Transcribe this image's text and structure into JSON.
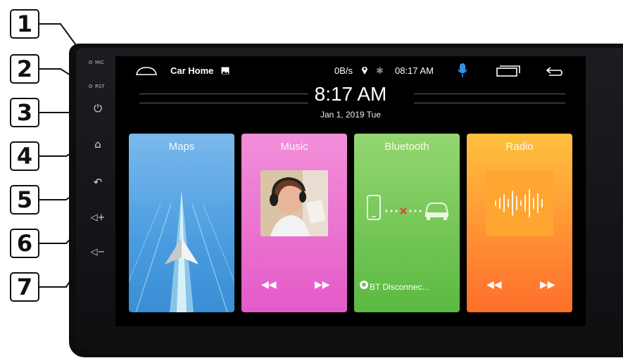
{
  "callouts": [
    "1",
    "2",
    "3",
    "4",
    "5",
    "6",
    "7"
  ],
  "side_panel": {
    "mic_label": "MIC",
    "rst_label": "RST",
    "buttons": [
      {
        "icon": "power-icon",
        "glyph": "⏻"
      },
      {
        "icon": "home-icon",
        "glyph": "⌂"
      },
      {
        "icon": "back-icon",
        "glyph": "↶"
      },
      {
        "icon": "volume-up-icon",
        "glyph": "◁+"
      },
      {
        "icon": "volume-down-icon",
        "glyph": "◁−"
      }
    ]
  },
  "statusbar": {
    "title": "Car Home",
    "net_speed": "0B/s",
    "time": "08:17 AM",
    "icons": [
      "home-outline-icon",
      "image-icon",
      "location-icon",
      "bluetooth-icon",
      "microphone-icon",
      "recent-apps-icon",
      "back-arrow-icon"
    ]
  },
  "clock": {
    "time": "8:17 AM",
    "date": "Jan 1, 2019  Tue"
  },
  "cards": [
    {
      "title": "Maps",
      "color_top": "#74b6ea",
      "color_bottom": "#3f93d8"
    },
    {
      "title": "Music",
      "color_top": "#f08ad6",
      "color_bottom": "#e055c4"
    },
    {
      "title": "Bluetooth",
      "color_top": "#8fd46a",
      "color_bottom": "#58b83e",
      "status": "BT Disconnec..."
    },
    {
      "title": "Radio",
      "color_top": "#ffbd3c",
      "color_bottom": "#ff7a2c"
    }
  ],
  "accent": {
    "mic": "#3b8fe0"
  }
}
